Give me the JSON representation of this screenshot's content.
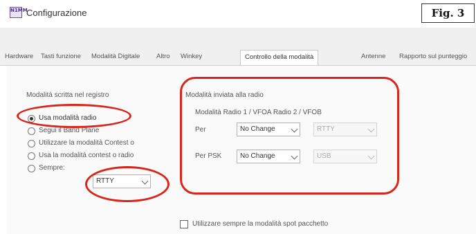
{
  "window": {
    "title": "Configurazione",
    "app_icon_text": "N1MM",
    "figure_label": "Fig. 3"
  },
  "tabs": [
    {
      "label": "Hardware"
    },
    {
      "label": "Tasti funzione"
    },
    {
      "label": "Modalità Digitale"
    },
    {
      "label": "Altro"
    },
    {
      "label": "Winkey"
    },
    {
      "label": "Controllo della modalità",
      "active": true
    },
    {
      "label": "Antenne"
    },
    {
      "label": "Rapporto sul punteggio"
    }
  ],
  "log_mode": {
    "title": "Modalità scritta nel registro",
    "options": [
      {
        "label": "Usa modalità radio",
        "checked": true
      },
      {
        "label": "Segui il Band Plane"
      },
      {
        "label": "Utilizzare la modalità Contest o"
      },
      {
        "label": "Usa la modalità contest o radio"
      },
      {
        "label": "Sempre:"
      }
    ],
    "always_value": "RTTY"
  },
  "radio_mode": {
    "title": "Modalità inviata alla radio",
    "subtitle": "Modalità Radio 1 / VFOA Radio 2 / VFOB",
    "rows": [
      {
        "label": "Per",
        "vfoa": "No Change",
        "vfob": "RTTY"
      },
      {
        "label": "Per PSK",
        "vfoa": "No Change",
        "vfob": "USB"
      }
    ]
  },
  "packet_spot": {
    "label": "Utilizzare sempre la modalità spot pacchetto",
    "checked": false
  },
  "colors": {
    "annotation": "#d9261c",
    "tab_bar": "#f0f0f0"
  }
}
